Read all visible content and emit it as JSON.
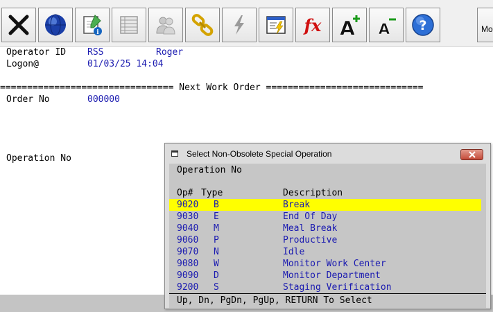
{
  "toolbar": {
    "buttons": [
      {
        "name": "exit-button",
        "icon": "x-cross-icon"
      },
      {
        "name": "globe-button",
        "icon": "globe-icon"
      },
      {
        "name": "info-edit-button",
        "icon": "notepad-info-icon"
      },
      {
        "name": "list-button",
        "icon": "list-icon"
      },
      {
        "name": "users-button",
        "icon": "users-icon"
      },
      {
        "name": "link-button",
        "icon": "chain-link-icon"
      },
      {
        "name": "lightning-button",
        "icon": "lightning-icon"
      },
      {
        "name": "window-lightning-button",
        "icon": "window-lightning-icon"
      },
      {
        "name": "function-button",
        "icon": "fx-icon"
      },
      {
        "name": "font-larger-button",
        "icon": "font-increase-icon"
      },
      {
        "name": "font-smaller-button",
        "icon": "font-decrease-icon"
      },
      {
        "name": "help-button",
        "icon": "question-icon"
      }
    ],
    "more_label": "Mo"
  },
  "screen": {
    "operator_label": "Operator ID",
    "operator_id": "RSS",
    "operator_name": "Roger",
    "logon_label": "Logon@",
    "logon_time": "01/03/25 14:04",
    "separator": "================================ Next Work Order =============================",
    "order_label": "Order No",
    "order_value": "000000",
    "operation_label": "Operation No"
  },
  "dialog": {
    "title": "Select Non-Obsolete Special Operation",
    "field_label": "Operation No",
    "headers": {
      "op": "Op#",
      "type": "Type",
      "description": "Description"
    },
    "rows": [
      {
        "op": "9020",
        "type": "B",
        "description": "Break",
        "selected": true
      },
      {
        "op": "9030",
        "type": "E",
        "description": "End Of Day"
      },
      {
        "op": "9040",
        "type": "M",
        "description": "Meal Break"
      },
      {
        "op": "9060",
        "type": "P",
        "description": "Productive"
      },
      {
        "op": "9070",
        "type": "N",
        "description": "Idle"
      },
      {
        "op": "9080",
        "type": "W",
        "description": "Monitor Work Center"
      },
      {
        "op": "9090",
        "type": "D",
        "description": "Monitor Department"
      },
      {
        "op": "9200",
        "type": "S",
        "description": "Staging Verification"
      }
    ],
    "footer": "Up, Dn, PgDn, PgUp, RETURN To Select"
  },
  "colors": {
    "value_text": "#1a1ab0",
    "selection": "#ffff00",
    "dialog_bg": "#c6c6c6"
  }
}
